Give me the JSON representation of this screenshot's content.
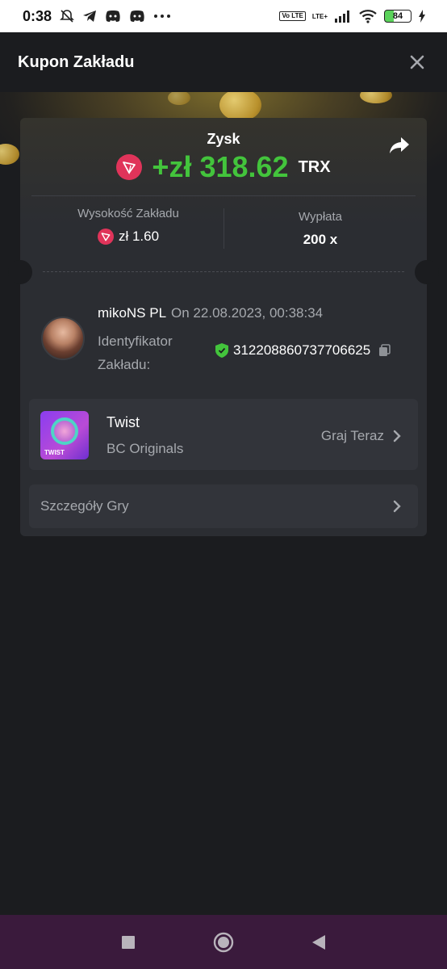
{
  "status_bar": {
    "time": "0:38",
    "icons": [
      "bell-off-icon",
      "telegram-icon",
      "discord-icon",
      "discord-icon",
      "more-icon"
    ],
    "volte": "Vo LTE",
    "lte": "LTE+",
    "battery": "84"
  },
  "header": {
    "title": "Kupon Zakładu",
    "close_icon": "close-icon"
  },
  "profit": {
    "label": "Zysk",
    "value": "+zł 318.62",
    "currency": "TRX",
    "currency_icon": "tron-icon",
    "color": "#43c43c"
  },
  "stats": {
    "bet_label": "Wysokość Zakładu",
    "bet_value": "zł 1.60",
    "payout_label": "Wypłata",
    "payout_value": "200 x"
  },
  "user": {
    "name": "mikoNS PL",
    "timestamp": "On 22.08.2023, 00:38:34",
    "id_label": "Identyfikator Zakładu:",
    "bet_id": "312208860737706625"
  },
  "game": {
    "name": "Twist",
    "provider": "BC Originals",
    "play_label": "Graj Teraz",
    "thumb_label": "TWIST"
  },
  "details": {
    "label": "Szczegóły Gry"
  },
  "nav": {
    "icons": [
      "recents-icon",
      "home-icon",
      "back-icon"
    ]
  }
}
